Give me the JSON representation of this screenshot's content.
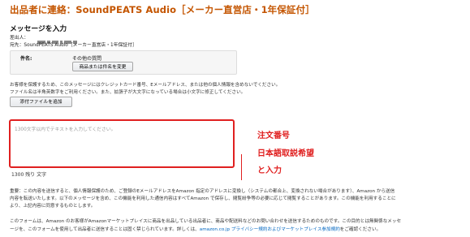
{
  "header": {
    "title": "出品者に連絡：SoundPEATS Audio［メーカー直営店・1年保証付］"
  },
  "compose": {
    "section_title": "メッセージを入力",
    "from_label": "差出人：",
    "to_text": "宛先：SoundPEATS Audio［メーカー直営店・1年保証付］",
    "subject_label": "件名:",
    "subject_value": "その他の質問",
    "change_subject_button": "商品または件名を変更",
    "privacy_notice_1": "お客様を保護するため、このメッセージにはクレジットカード番号、Eメールアドレス、または他の個人情報を含めないでください。",
    "privacy_notice_2": "ファイル名は半角英数字をご利用ください。また、拡張子が大文字になっている場合は小文字に修正してください。",
    "attach_button": "添付ファイルを追加",
    "message_placeholder": "1300文字以内でテキストを入力してください。",
    "char_counter": "1300 残り 文字"
  },
  "annotations": {
    "line1": "注文番号",
    "line2": "日本語取説希望",
    "line3": "と入力"
  },
  "footer": {
    "line1": "重要：この内容を送信すると、個人情報保護のため、ご登録のEメールアドレスをAmazon 指定のアドレスに変換し（システムの都合上、変換されない場合があります）、Amazon から送信",
    "line2": "内容を転送いたします。以下のメッセージを含め、この機能を利用した通信内容はすべてAmazon で保存し、閲覧紛争等の必要に応じて閲覧することがあります。この機能を利用することに",
    "line3": "より、上記内容に同意するものとします。",
    "line4": "このフォームは、Amazon のお客様がAmazonマーケットプレイスに商品を出品している出品者に、商品や配送料などのお問い合わせを送信するためのものです。この目的とは無関係なメッセ",
    "line5_prefix": "ージを、このフォームを使用して出品者に送信することは固く禁じられています。詳しくは、",
    "line5_link": "amazon.co.jp プライバシー規約およびマーケットプレイス参加規約",
    "line5_suffix": "をご確認ください。"
  },
  "colors": {
    "title": "#c45500",
    "annotation": "#e02020",
    "link": "#0066c0"
  }
}
